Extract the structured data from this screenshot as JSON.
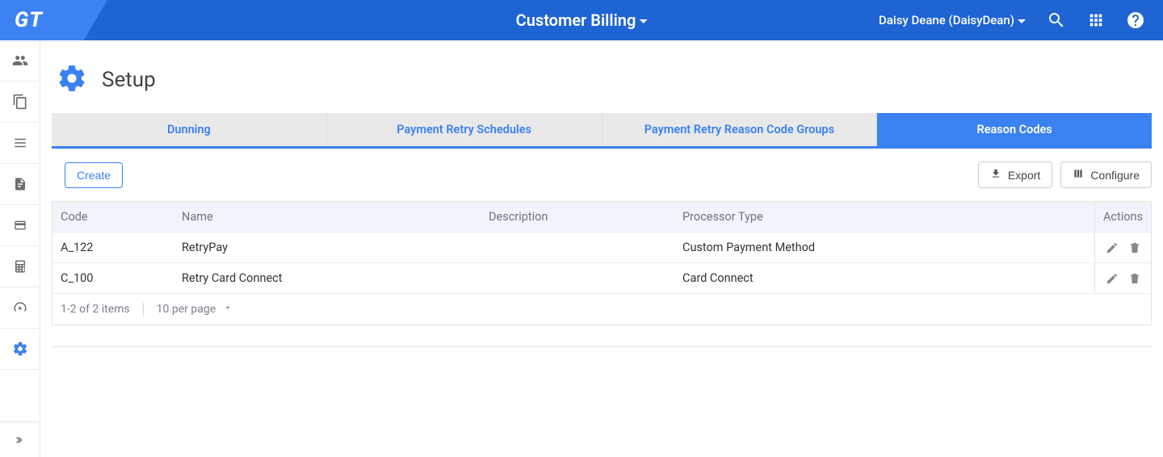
{
  "header": {
    "logo": "GT",
    "title": "Customer Billing",
    "user": "Daisy Deane (DaisyDean)"
  },
  "sidebar": {
    "items": [
      "customers",
      "copy",
      "list",
      "document",
      "card",
      "calculator",
      "dashboard",
      "settings"
    ]
  },
  "page": {
    "title": "Setup"
  },
  "tabs": [
    {
      "label": "Dunning",
      "active": false
    },
    {
      "label": "Payment Retry Schedules",
      "active": false
    },
    {
      "label": "Payment Retry Reason Code Groups",
      "active": false
    },
    {
      "label": "Reason Codes",
      "active": true
    }
  ],
  "toolbar": {
    "create": "Create",
    "export": "Export",
    "configure": "Configure"
  },
  "table": {
    "headers": {
      "code": "Code",
      "name": "Name",
      "description": "Description",
      "processor": "Processor Type",
      "actions": "Actions"
    },
    "rows": [
      {
        "code": "A_122",
        "name": "RetryPay",
        "description": "",
        "processor": "Custom Payment Method"
      },
      {
        "code": "C_100",
        "name": "Retry Card Connect",
        "description": "",
        "processor": "Card Connect"
      }
    ],
    "footer": {
      "range": "1-2 of 2 items",
      "perpage": "10 per page"
    }
  }
}
